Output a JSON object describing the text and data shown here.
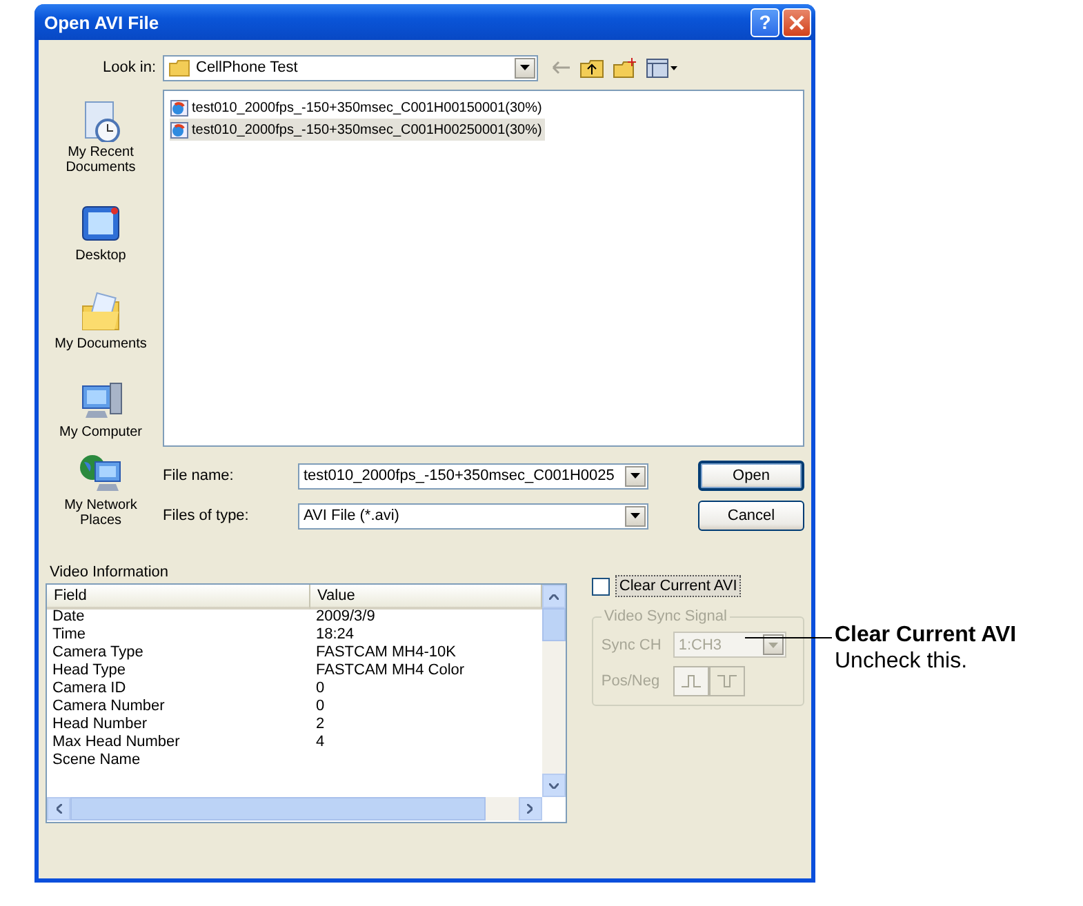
{
  "window": {
    "title": "Open AVI File",
    "help": "?"
  },
  "look_in": {
    "label": "Look in:",
    "value": "CellPhone Test"
  },
  "places": [
    {
      "label": "My Recent Documents",
      "kind": "recent"
    },
    {
      "label": "Desktop",
      "kind": "desktop"
    },
    {
      "label": "My Documents",
      "kind": "documents"
    },
    {
      "label": "My Computer",
      "kind": "computer"
    },
    {
      "label": "My Network Places",
      "kind": "network"
    }
  ],
  "files": [
    {
      "name": "test010_2000fps_-150+350msec_C001H00150001(30%)",
      "selected": false
    },
    {
      "name": "test010_2000fps_-150+350msec_C001H00250001(30%)",
      "selected": true
    }
  ],
  "file_name": {
    "label": "File name:",
    "value": "test010_2000fps_-150+350msec_C001H0025"
  },
  "file_type": {
    "label": "Files of type:",
    "value": "AVI File (*.avi)"
  },
  "buttons": [
    {
      "label": "Open",
      "default": true
    },
    {
      "label": "Cancel",
      "default": false
    }
  ],
  "video_info": {
    "title": "Video Information",
    "columns": [
      "Field",
      "Value"
    ],
    "rows": [
      [
        "Date",
        "2009/3/9"
      ],
      [
        "Time",
        "18:24"
      ],
      [
        "Camera Type",
        "FASTCAM MH4-10K"
      ],
      [
        "Head Type",
        "FASTCAM MH4 Color"
      ],
      [
        "Camera ID",
        "0"
      ],
      [
        "Camera Number",
        "0"
      ],
      [
        "Head Number",
        "2"
      ],
      [
        "Max Head Number",
        "4"
      ],
      [
        "Scene Name",
        ""
      ]
    ]
  },
  "clear_current": {
    "label": "Clear Current AVI",
    "checked": false
  },
  "sync": {
    "title": "Video Sync Signal",
    "disabled": true,
    "sync_ch": {
      "label": "Sync CH",
      "value": "1:CH3"
    },
    "pos_neg": {
      "label": "Pos/Neg"
    }
  },
  "callout": {
    "title": "Clear Current AVI",
    "text": "Uncheck this."
  }
}
